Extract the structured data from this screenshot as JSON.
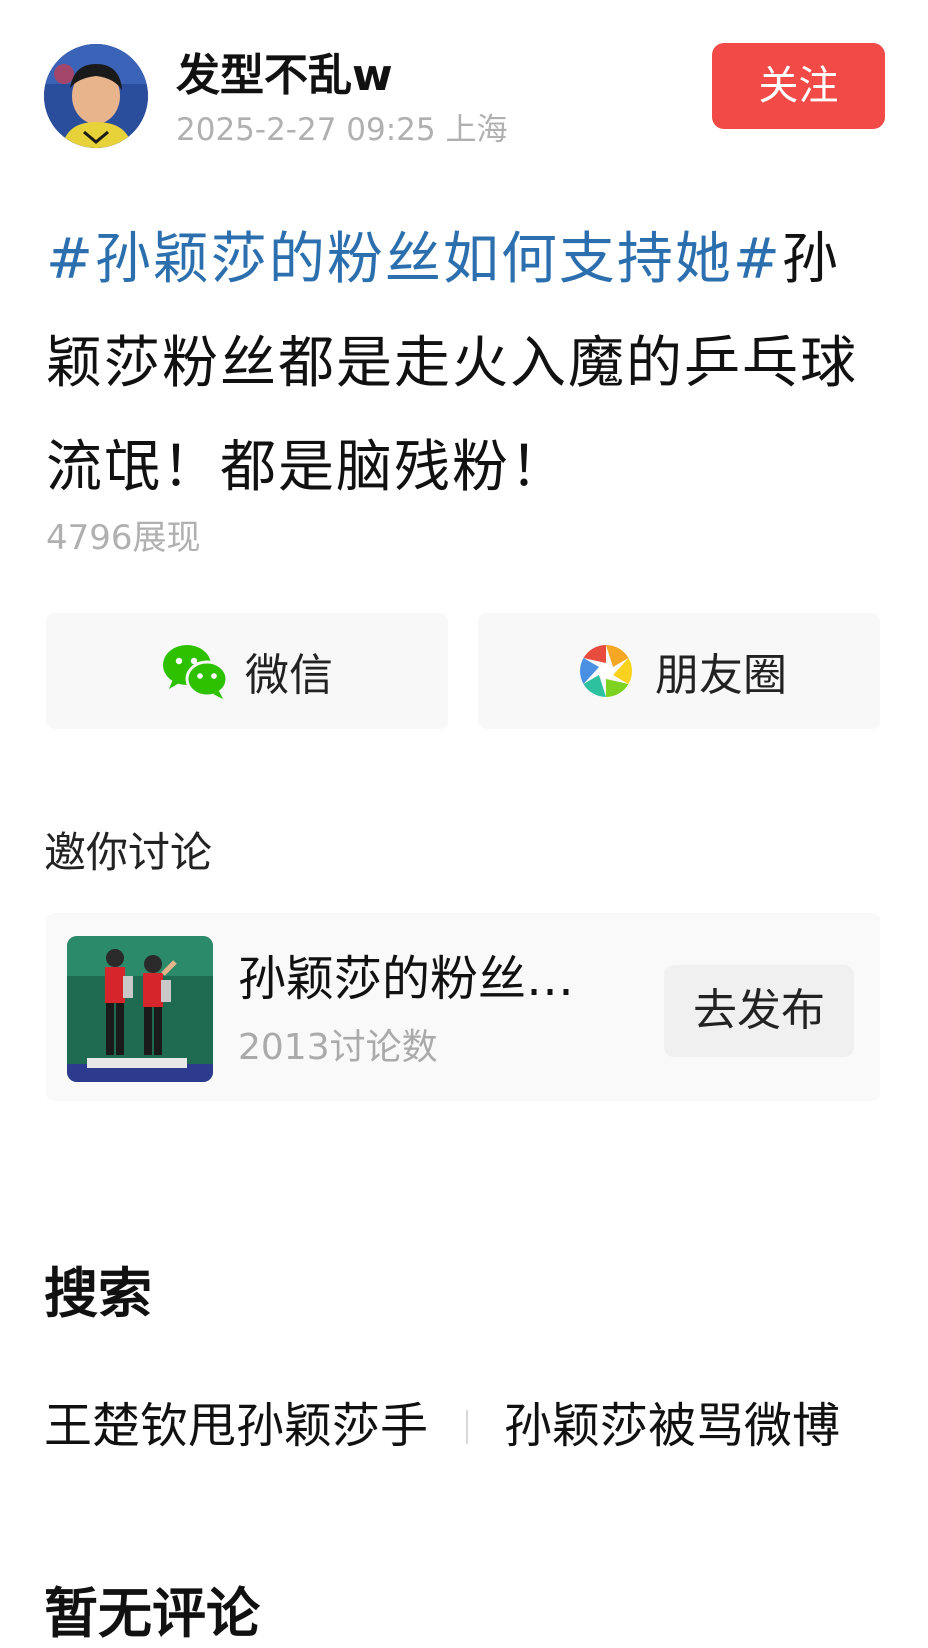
{
  "author": {
    "name": "发型不乱w",
    "meta": "2025-2-27 09:25 上海",
    "follow_label": "关注"
  },
  "post": {
    "hashtag": "#孙颖莎的粉丝如何支持她#",
    "text": "孙颖莎粉丝都是走火入魔的乒乓球流氓！都是脑残粉！",
    "views": "4796展现"
  },
  "share": {
    "wechat_label": "微信",
    "moments_label": "朋友圈"
  },
  "discussion": {
    "section_label": "邀你讨论",
    "topic_title": "孙颖莎的粉丝如何支持她",
    "topic_count": "2013讨论数",
    "publish_label": "去发布"
  },
  "search": {
    "heading": "搜索",
    "suggestions": [
      "王楚钦甩孙颖莎手",
      "孙颖莎被骂微博"
    ]
  },
  "comments": {
    "heading": "暂无评论"
  },
  "colors": {
    "follow_button": "#f24a46",
    "hashtag": "#2b6fae",
    "meta_text": "#b0b0b0",
    "wechat_green": "#2dc100"
  }
}
